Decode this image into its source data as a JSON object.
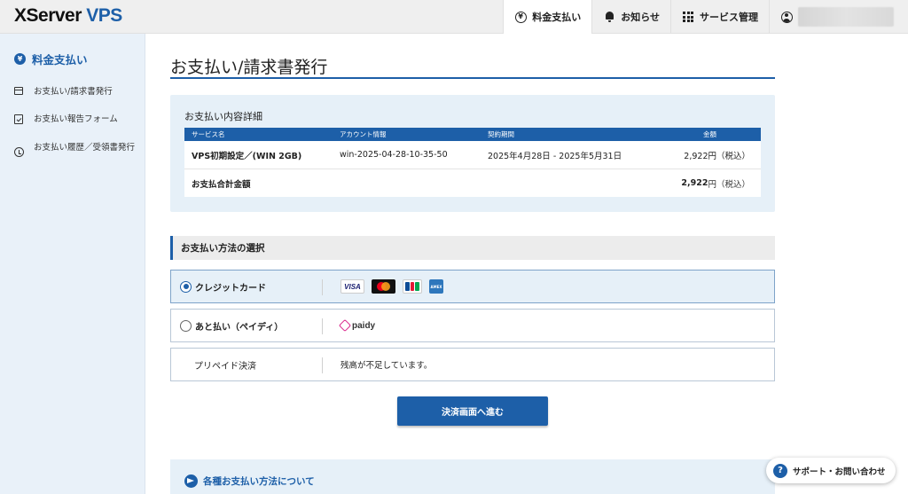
{
  "header": {
    "logo_main": "XServer",
    "logo_accent": "VPS",
    "nav": [
      {
        "label": "料金支払い",
        "icon": "yen-circle-icon"
      },
      {
        "label": "お知らせ",
        "icon": "bell-icon"
      },
      {
        "label": "サービス管理",
        "icon": "grid-icon"
      }
    ]
  },
  "sidebar": {
    "title": "料金支払い",
    "items": [
      {
        "label": "お支払い/請求書発行",
        "icon": "invoice-icon"
      },
      {
        "label": "お支払い報告フォーム",
        "icon": "report-form-icon"
      },
      {
        "label": "お支払い履歴／受領書発行",
        "icon": "history-clock-icon"
      }
    ]
  },
  "main": {
    "title": "お支払い/請求書発行",
    "details": {
      "title": "お支払い内容詳細",
      "columns": [
        "サービス名",
        "アカウント情報",
        "契約期間",
        "金額"
      ],
      "rows": [
        {
          "service": "VPS初期設定／(WIN 2GB)",
          "account": "win-2025-04-28-10-35-50",
          "period": "2025年4月28日 - 2025年5月31日",
          "amount": "2,922円（税込）"
        }
      ],
      "total_label": "お支払合計金額",
      "total_amount": "2,922",
      "total_unit": "円（税込）"
    },
    "method_section_title": "お支払い方法の選択",
    "methods": [
      {
        "label": "クレジットカード",
        "selected": true,
        "cards": [
          "VISA",
          "Mastercard",
          "JCB",
          "AMEX"
        ]
      },
      {
        "label": "あと払い（ペイディ）",
        "selected": false,
        "brand": "paidy"
      },
      {
        "label": "プリペイド決済",
        "note": "残高が不足しています。"
      }
    ],
    "submit_label": "決済画面へ進む",
    "info_title": "各種お支払い方法について"
  },
  "support": {
    "label": "サポート・お問い合わせ"
  },
  "colors": {
    "accent": "#1d5fa8",
    "panel": "#e6f0f8"
  }
}
